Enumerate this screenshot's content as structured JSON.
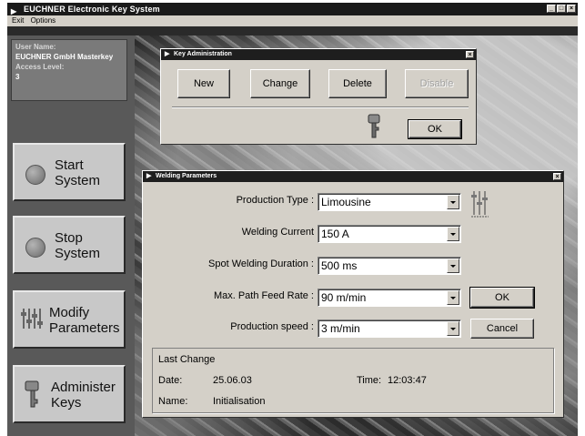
{
  "app": {
    "title": "EUCHNER  Electronic Key System",
    "menu": [
      "Exit",
      "Options"
    ]
  },
  "user_panel": {
    "user_name_label": "User Name:",
    "user_name_value": "EUCHNER GmbH Masterkey",
    "access_level_label": "Access Level:",
    "access_level_value": "3"
  },
  "sidebar": {
    "start_line1": "Start",
    "start_line2": "System",
    "stop_line1": "Stop",
    "stop_line2": "System",
    "modify_line1": "Modify",
    "modify_line2": "Parameters",
    "administer_line1": "Administer",
    "administer_line2": "Keys"
  },
  "key_admin": {
    "title": "Key Administration",
    "buttons": {
      "new": "New",
      "change": "Change",
      "delete": "Delete",
      "disable": "Disable",
      "ok": "OK"
    },
    "key_icon": "key-icon"
  },
  "welding": {
    "title": "Welding Parameters",
    "fields": [
      {
        "label": "Production Type :",
        "value": "Limousine"
      },
      {
        "label": "Welding Current",
        "value": "150 A"
      },
      {
        "label": "Spot Welding Duration :",
        "value": "500 ms"
      },
      {
        "label": "Max. Path Feed Rate :",
        "value": "90 m/min"
      },
      {
        "label": "Production speed :",
        "value": "3 m/min"
      }
    ],
    "ok": "OK",
    "cancel": "Cancel",
    "sliders_icon": "sliders-icon",
    "last_change": {
      "heading": "Last Change",
      "date_label": "Date:",
      "date_value": "25.06.03",
      "time_label": "Time:",
      "time_value": "12:03:47",
      "name_label": "Name:",
      "name_value": "Initialisation"
    }
  },
  "colors": {
    "titlebar": "#1a1a1a",
    "dialog_face": "#d4d0c8",
    "sidebar": "#595959"
  }
}
